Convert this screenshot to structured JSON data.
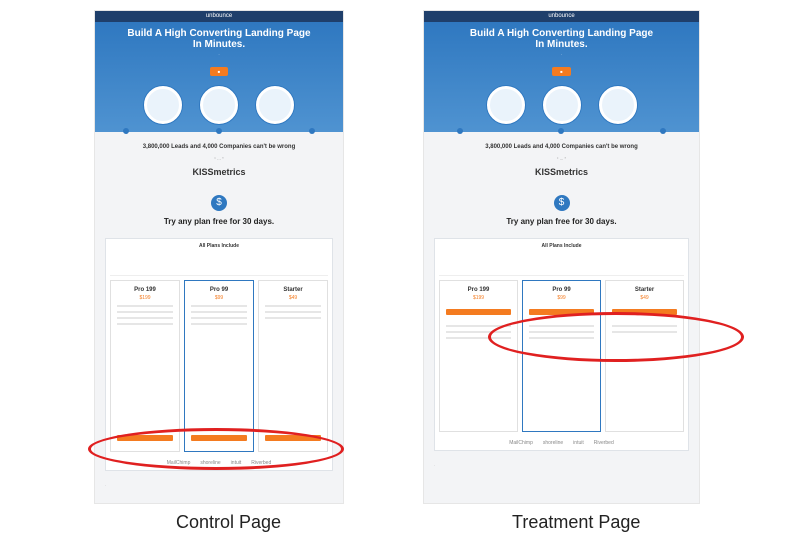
{
  "brand": "unbounce",
  "hero": {
    "headline_line1": "Build A High Converting Landing Page",
    "headline_line2": "In Minutes."
  },
  "social_proof": {
    "headline": "3,800,000 Leads and 4,000 Companies can't be wrong"
  },
  "testimonial": {
    "logo": "KISSmetrics"
  },
  "pricing": {
    "badge": "$",
    "headline": "Try any plan free for 30 days.",
    "features_title": "All Plans Include",
    "plans": [
      {
        "name": "Pro 199",
        "price": "$199"
      },
      {
        "name": "Pro 99",
        "price": "$99"
      },
      {
        "name": "Starter",
        "price": "$49"
      }
    ]
  },
  "logos": [
    "MailChimp",
    "shoreline",
    "intuit",
    "Riverbed"
  ],
  "captions": {
    "left": "Control Page",
    "right": "Treatment Page"
  }
}
